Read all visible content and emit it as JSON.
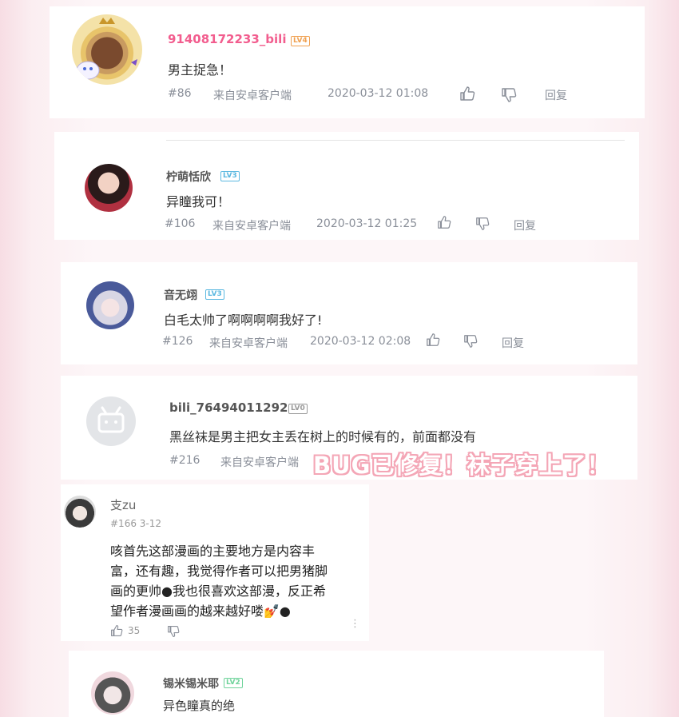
{
  "comments": [
    {
      "username": "91408172233_bili",
      "level": "LV4",
      "text": "男主捉急！",
      "floor": "#86",
      "client": "来自安卓客户端",
      "time": "2020-03-12 01:08",
      "reply": "回复"
    },
    {
      "username": "柠萌恬欣",
      "level": "LV3",
      "text": "异瞳我可！",
      "floor": "#106",
      "client": "来自安卓客户端",
      "time": "2020-03-12 01:25",
      "reply": "回复"
    },
    {
      "username": "音无翊",
      "level": "LV3",
      "text": "白毛太帅了啊啊啊啊我好了!",
      "floor": "#126",
      "client": "来自安卓客户端",
      "time": "2020-03-12 02:08",
      "reply": "回复"
    },
    {
      "username": "bili_76494011292",
      "level": "LV0",
      "text": "黑丝袜是男主把女主丢在树上的时候有的，前面都没有",
      "floor": "#216",
      "client": "来自安卓客户端"
    },
    {
      "username": "锡米锡米耶",
      "level": "LV2",
      "text": "异色瞳真的绝"
    }
  ],
  "overlay_text": "BUG已修复！袜子穿上了！",
  "app_comment": {
    "username": "支zu",
    "meta": "#166  3-12",
    "text_lines": [
      "咳首先这部漫画的主要地方是内容丰",
      "富，还有趣，我觉得作者可以把男猪脚",
      "画的更帅●我也很喜欢这部漫，反正希",
      "望作者漫画画的越来越好喽💅●"
    ],
    "likes": "35"
  },
  "colors": {
    "username_pink": "#f25d8e",
    "overlay_pink": "#f4a6b6",
    "lv_blue": "#5bb8e0",
    "lv_orange": "#f0a050",
    "lv_green": "#6ed39a",
    "lv_gray": "#9a9a9a"
  }
}
